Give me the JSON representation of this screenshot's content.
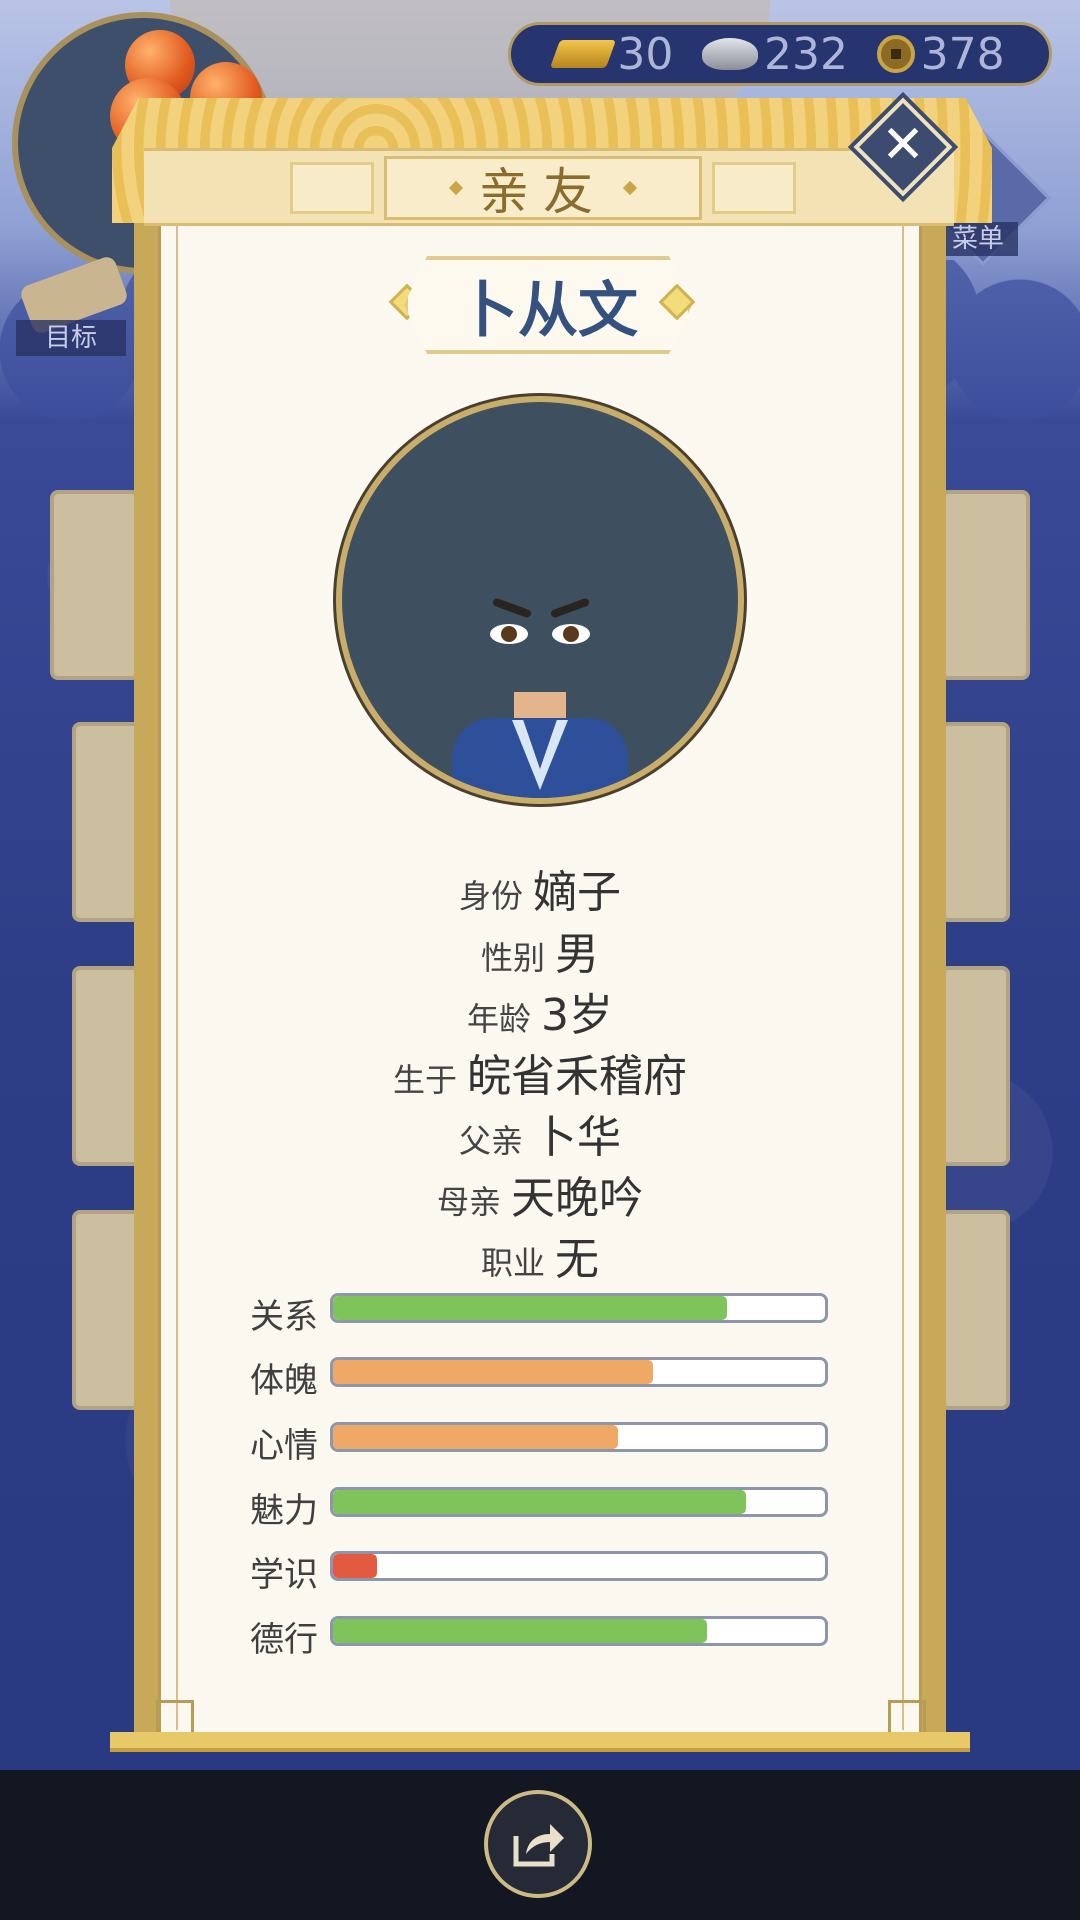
{
  "currency": {
    "gold": "30",
    "silver": "232",
    "copper": "378"
  },
  "hud": {
    "menu_label": "菜单",
    "goal_label": "目标"
  },
  "dialog": {
    "title": "亲友",
    "close_icon": "close-icon",
    "name": "卜从文"
  },
  "info": [
    {
      "label": "身份",
      "value": "嫡子"
    },
    {
      "label": "性别",
      "value": "男"
    },
    {
      "label": "年龄",
      "value": "3岁"
    },
    {
      "label": "生于",
      "value": "皖省禾稽府"
    },
    {
      "label": "父亲",
      "value": "卜华"
    },
    {
      "label": "母亲",
      "value": "天晚吟"
    },
    {
      "label": "职业",
      "value": "无"
    }
  ],
  "stats": [
    {
      "label": "关系",
      "value": 0.8,
      "color": "#7fc45a"
    },
    {
      "label": "体魄",
      "value": 0.65,
      "color": "#f0a866"
    },
    {
      "label": "心情",
      "value": 0.58,
      "color": "#f0a866"
    },
    {
      "label": "魅力",
      "value": 0.84,
      "color": "#7fc45a"
    },
    {
      "label": "学识",
      "value": 0.09,
      "color": "#e35a40"
    },
    {
      "label": "德行",
      "value": 0.76,
      "color": "#7fc45a"
    }
  ],
  "bottom": {
    "share_icon": "share-icon"
  }
}
